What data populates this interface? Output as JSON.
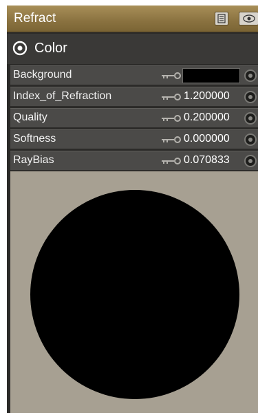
{
  "panel": {
    "title": "Refract",
    "toolbar_icons": [
      "list-icon",
      "eye-icon"
    ]
  },
  "group": {
    "label": "Color",
    "icon": "target-icon"
  },
  "properties": [
    {
      "label": "Background",
      "type": "color",
      "color": "#000000"
    },
    {
      "label": "Index_of_Refraction",
      "type": "number",
      "value": "1.200000"
    },
    {
      "label": "Quality",
      "type": "number",
      "value": "0.200000"
    },
    {
      "label": "Softness",
      "type": "number",
      "value": "0.000000"
    },
    {
      "label": "RayBias",
      "type": "number",
      "value": "0.070833"
    }
  ],
  "colors": {
    "title_bar": "#8a7240",
    "panel_bg": "#2b2a28",
    "row_bg": "#4b4a48",
    "preview_bg": "#a7a092",
    "preview_sphere": "#000000"
  }
}
